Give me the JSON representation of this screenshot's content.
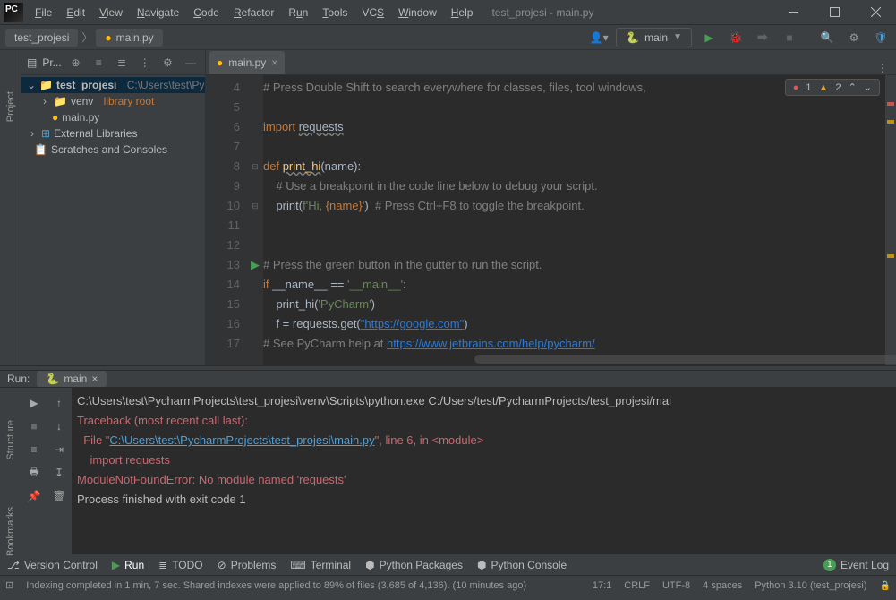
{
  "title": "test_projesi - main.py",
  "menu": [
    "File",
    "Edit",
    "View",
    "Navigate",
    "Code",
    "Refactor",
    "Run",
    "Tools",
    "VCS",
    "Window",
    "Help"
  ],
  "breadcrumb": {
    "project": "test_projesi",
    "file": "main.py"
  },
  "run_config": {
    "name": "main"
  },
  "project_panel": {
    "title": "Pr...",
    "root": "test_projesi",
    "root_path": "C:\\Users\\test\\Pych",
    "venv": "venv",
    "venv_hint": "library root",
    "file": "main.py",
    "external": "External Libraries",
    "scratches": "Scratches and Consoles"
  },
  "left_gutter": {
    "project": "Project",
    "structure": "Structure",
    "bookmarks": "Bookmarks"
  },
  "editor": {
    "tab": "main.py",
    "errors": "1",
    "warnings": "2",
    "lines": {
      "l4_cmt": "# Press Double Shift to search everywhere for classes, files, tool windows,",
      "l6_import": "import",
      "l6_req": "requests",
      "l8_def": "def ",
      "l8_fn": "print_hi",
      "l8_args": "(name):",
      "l9_cmt": "# Use a breakpoint in the code line below to debug your script.",
      "l10_print": "print",
      "l10_open": "(",
      "l10_f": "f'",
      "l10_hi": "Hi, ",
      "l10_br": "{name}",
      "l10_end": "'",
      "l10_close": ")  ",
      "l10_cmt": "# Press Ctrl+F8 to toggle the breakpoint.",
      "l13_cmt": "# Press the green button in the gutter to run the script.",
      "l14_if": "if ",
      "l14_name": "__name__",
      "l14_eq": " == ",
      "l14_main": "'__main__'",
      "l14_colon": ":",
      "l15_call": "print_hi(",
      "l15_arg": "'PyCharm'",
      "l15_close": ")",
      "l16_f": "f = requests.get(",
      "l16_url": "\"https://google.com\"",
      "l16_close": ")",
      "l17_cmt": "# See PyCharm help at ",
      "l17_url": "https://www.jetbrains.com/help/pycharm/"
    },
    "line_numbers": [
      "4",
      "5",
      "6",
      "7",
      "8",
      "9",
      "10",
      "11",
      "12",
      "13",
      "14",
      "15",
      "16",
      "17"
    ]
  },
  "run_panel": {
    "label": "Run:",
    "tab": "main",
    "output": {
      "exe_line": "C:\\Users\\test\\PycharmProjects\\test_projesi\\venv\\Scripts\\python.exe C:/Users/test/PycharmProjects/test_projesi/mai",
      "tb": "Traceback (most recent call last):",
      "file_pre": "  File \"",
      "file_link": "C:\\Users\\test\\PycharmProjects\\test_projesi\\main.py",
      "file_post": "\", line 6, in <module>",
      "import": "    import requests",
      "err": "ModuleNotFoundError: No module named 'requests'",
      "exit": "Process finished with exit code 1"
    }
  },
  "bottom": {
    "version_control": "Version Control",
    "run": "Run",
    "todo": "TODO",
    "problems": "Problems",
    "terminal": "Terminal",
    "py_packages": "Python Packages",
    "py_console": "Python Console",
    "event_log": "Event Log",
    "event_count": "1"
  },
  "status": {
    "indexing": "Indexing completed in 1 min, 7 sec. Shared indexes were applied to 89% of files (3,685 of 4,136). (10 minutes ago)",
    "line_col": "17:1",
    "line_sep": "CRLF",
    "encoding": "UTF-8",
    "indent": "4 spaces",
    "interpreter": "Python 3.10 (test_projesi)"
  }
}
